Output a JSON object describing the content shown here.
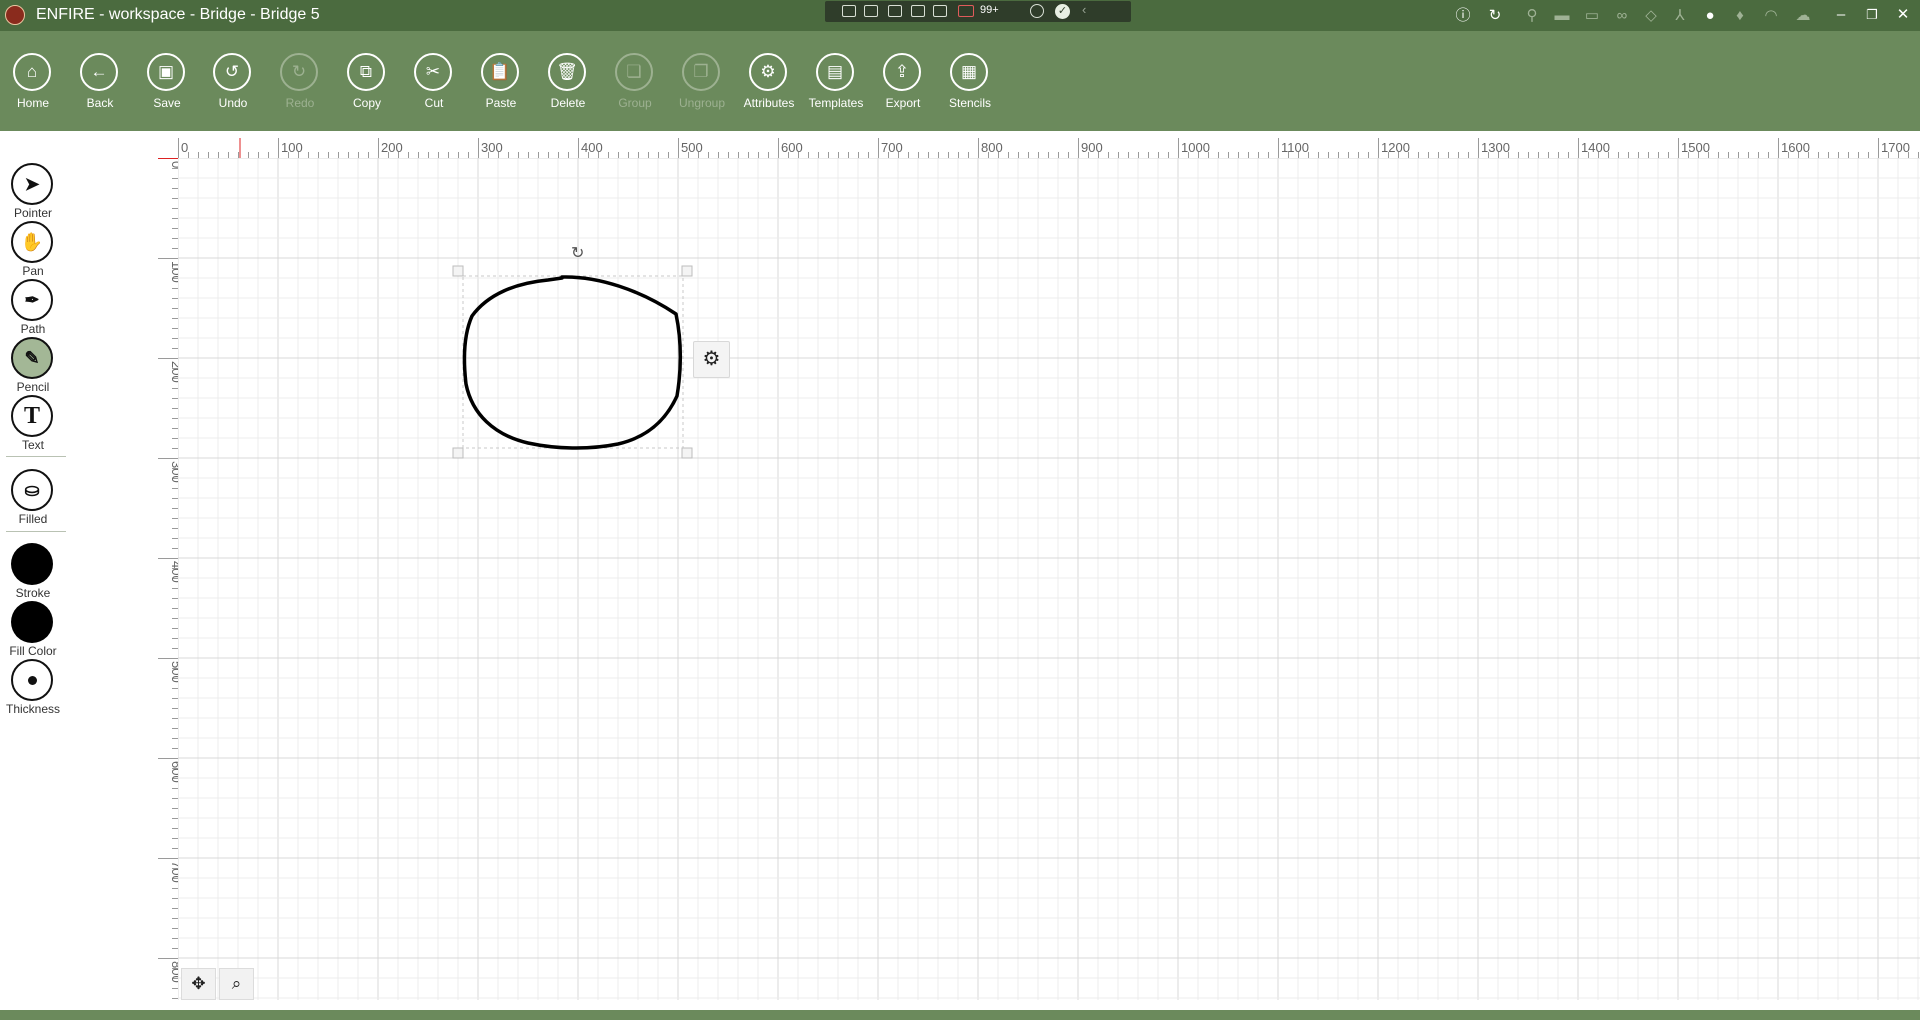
{
  "titlebar": {
    "title": "ENFIRE - workspace - Bridge - Bridge 5",
    "badge": "99+",
    "tray_icons": [
      "info-icon",
      "refresh-icon",
      "satellite-icon",
      "camera-icon",
      "video-icon",
      "binoculars-icon",
      "cube-icon",
      "axis-icon",
      "people-icon",
      "microphone-icon",
      "antenna-icon",
      "cloud-icon"
    ],
    "window_controls": [
      "minimize",
      "restore",
      "close"
    ]
  },
  "toolbar": {
    "buttons": [
      {
        "label": "Home",
        "icon": "home-icon",
        "enabled": true
      },
      {
        "label": "Back",
        "icon": "back-icon",
        "enabled": true
      },
      {
        "label": "Save",
        "icon": "save-icon",
        "enabled": true
      },
      {
        "label": "Undo",
        "icon": "undo-icon",
        "enabled": true
      },
      {
        "label": "Redo",
        "icon": "redo-icon",
        "enabled": false
      },
      {
        "label": "Copy",
        "icon": "copy-icon",
        "enabled": true
      },
      {
        "label": "Cut",
        "icon": "cut-icon",
        "enabled": true
      },
      {
        "label": "Paste",
        "icon": "paste-icon",
        "enabled": true
      },
      {
        "label": "Delete",
        "icon": "delete-icon",
        "enabled": true
      },
      {
        "label": "Group",
        "icon": "group-icon",
        "enabled": false
      },
      {
        "label": "Ungroup",
        "icon": "ungroup-icon",
        "enabled": false
      },
      {
        "label": "Attributes",
        "icon": "attributes-icon",
        "enabled": true
      },
      {
        "label": "Templates",
        "icon": "templates-icon",
        "enabled": true
      },
      {
        "label": "Export",
        "icon": "export-icon",
        "enabled": true
      },
      {
        "label": "Stencils",
        "icon": "stencils-icon",
        "enabled": true
      }
    ]
  },
  "sidebar": {
    "tools": [
      {
        "label": "Pointer",
        "icon": "pointer-icon",
        "active": false
      },
      {
        "label": "Pan",
        "icon": "hand-icon",
        "active": false
      },
      {
        "label": "Path",
        "icon": "pen-nib-icon",
        "active": false
      },
      {
        "label": "Pencil",
        "icon": "pencil-icon",
        "active": true
      },
      {
        "label": "Text",
        "icon": "text-icon",
        "active": false
      }
    ],
    "filled_label": "Filled",
    "stroke_label": "Stroke",
    "fill_color_label": "Fill Color",
    "thickness_label": "Thickness",
    "stroke_color": "#000000",
    "fill_color": "#000000"
  },
  "rulers": {
    "top_labels": [
      "0",
      "100",
      "200",
      "300",
      "400",
      "500",
      "600",
      "700",
      "800",
      "900",
      "1000",
      "1100",
      "1200",
      "1300",
      "1400",
      "1500",
      "1600",
      "1700"
    ],
    "left_labels": [
      "0",
      "100",
      "200",
      "300",
      "400",
      "500",
      "600",
      "700",
      "800"
    ]
  },
  "colors": {
    "titlebar": "#4b6b3f",
    "toolbar": "#6b8a5c",
    "active_tool": "#a3b796"
  }
}
